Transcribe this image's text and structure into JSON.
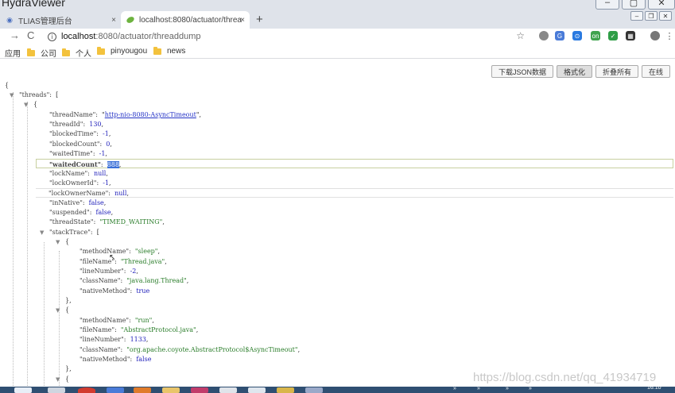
{
  "window": {
    "title": "HydraViewer"
  },
  "tabs": [
    {
      "label": "TLIAS管理后台",
      "close": "×"
    },
    {
      "label": "localhost:8080/actuator/threa",
      "close": "×"
    }
  ],
  "new_tab": "+",
  "toolbar": {
    "back": "→",
    "reload": "C",
    "url_host": "localhost",
    "url_path": ":8080/actuator/threaddump"
  },
  "bookmarks": [
    {
      "label": "应用"
    },
    {
      "label": "公司"
    },
    {
      "label": "个人"
    },
    {
      "label": "pinyougou"
    },
    {
      "label": "news"
    }
  ],
  "viewer_buttons": [
    {
      "label": "下载JSON数据"
    },
    {
      "label": "格式化"
    },
    {
      "label": "折叠所有"
    },
    {
      "label": "在线"
    }
  ],
  "json": {
    "root_open": "{",
    "threads_key": "\"threads\"",
    "arr_open": "[",
    "obj_open": "{",
    "threadName_key": "\"threadName\"",
    "threadName_val": "http-nio-8080-AsyncTimeout",
    "threadId_key": "\"threadId\"",
    "threadId_val": "130",
    "blockedTime_key": "\"blockedTime\"",
    "blockedTime_val": "-1",
    "blockedCount_key": "\"blockedCount\"",
    "blockedCount_val": "0",
    "waitedTime_key": "\"waitedTime\"",
    "waitedTime_val": "-1",
    "waitedCount_key": "\"waitedCount\"",
    "waitedCount_val": "888",
    "lockName_key": "\"lockName\"",
    "lockName_val": "null",
    "lockOwnerId_key": "\"lockOwnerId\"",
    "lockOwnerId_val": "-1",
    "lockOwnerName_key": "\"lockOwnerName\"",
    "lockOwnerName_val": "null",
    "inNative_key": "\"inNative\"",
    "inNative_val": "false",
    "suspended_key": "\"suspended\"",
    "suspended_val": "false",
    "threadState_key": "\"threadState\"",
    "threadState_val": "\"TIMED_WAITING\"",
    "stackTrace_key": "\"stackTrace\"",
    "frames": [
      {
        "methodName_key": "\"methodName\"",
        "methodName_val": "\"sleep\"",
        "fileName_key": "\"fileName\"",
        "fileName_val": "\"Thread.java\"",
        "lineNumber_key": "\"lineNumber\"",
        "lineNumber_val": "-2",
        "className_key": "\"className\"",
        "className_val": "\"java.lang.Thread\"",
        "nativeMethod_key": "\"nativeMethod\"",
        "nativeMethod_val": "true"
      },
      {
        "methodName_key": "\"methodName\"",
        "methodName_val": "\"run\"",
        "fileName_key": "\"fileName\"",
        "fileName_val": "\"AbstractProtocol.java\"",
        "lineNumber_key": "\"lineNumber\"",
        "lineNumber_val": "1133",
        "className_key": "\"className\"",
        "className_val": "\"org.apache.coyote.AbstractProtocol$AsyncTimeout\"",
        "nativeMethod_key": "\"nativeMethod\"",
        "nativeMethod_val": "false"
      }
    ],
    "obj_close": "},",
    "next_open": "{"
  },
  "watermark": "https://blog.csdn.net/qq_41934719",
  "taskbar_clock": "16:10",
  "colors": {
    "string": "#2a7d2a",
    "number": "#2222bb",
    "link": "#2433c6",
    "selection": "#3a6fd8",
    "taskbar": "#2f4f72"
  }
}
